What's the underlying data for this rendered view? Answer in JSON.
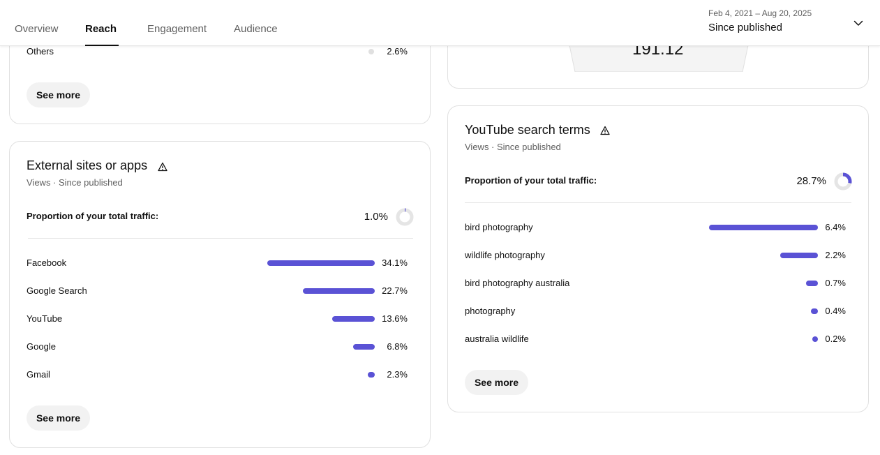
{
  "header": {
    "tabs": [
      {
        "label": "Overview"
      },
      {
        "label": "Reach"
      },
      {
        "label": "Engagement"
      },
      {
        "label": "Audience"
      }
    ],
    "active_tab": "Reach",
    "date_range": {
      "range": "Feb 4, 2021 – Aug 20, 2025",
      "label": "Since published"
    }
  },
  "top_left_card": {
    "others_row": {
      "label": "Others",
      "value": "2.6%"
    },
    "see_more": "See more"
  },
  "top_right_card": {
    "gauge_value": "191.12"
  },
  "external_sites": {
    "title": "External sites or apps",
    "subtitle": "Views · Since published",
    "proportion_label": "Proportion of your total traffic:",
    "proportion_value": "1.0%",
    "proportion_fraction": 0.01,
    "rows": [
      {
        "label": "Facebook",
        "value": "34.1%",
        "pct": 34.1
      },
      {
        "label": "Google Search",
        "value": "22.7%",
        "pct": 22.7
      },
      {
        "label": "YouTube",
        "value": "13.6%",
        "pct": 13.6
      },
      {
        "label": "Google",
        "value": "6.8%",
        "pct": 6.8
      },
      {
        "label": "Gmail",
        "value": "2.3%",
        "pct": 2.3
      }
    ],
    "see_more": "See more"
  },
  "search_terms": {
    "title": "YouTube search terms",
    "subtitle": "Views · Since published",
    "proportion_label": "Proportion of your total traffic:",
    "proportion_value": "28.7%",
    "proportion_fraction": 0.287,
    "rows": [
      {
        "label": "bird photography",
        "value": "6.4%",
        "pct": 6.4
      },
      {
        "label": "wildlife photography",
        "value": "2.2%",
        "pct": 2.2
      },
      {
        "label": "bird photography australia",
        "value": "0.7%",
        "pct": 0.7
      },
      {
        "label": "photography",
        "value": "0.4%",
        "pct": 0.4
      },
      {
        "label": "australia wildlife",
        "value": "0.2%",
        "pct": 0.2
      }
    ],
    "see_more": "See more"
  },
  "colors": {
    "bar": "#5a52d5",
    "others_dot": "#e0e0e0",
    "donut_track": "#e5e5e5"
  }
}
